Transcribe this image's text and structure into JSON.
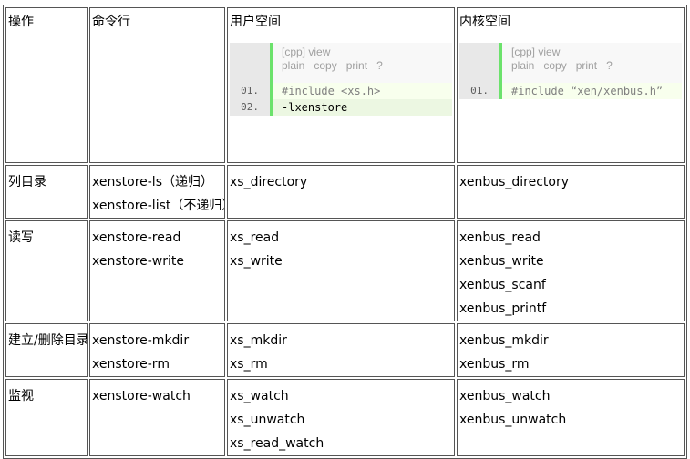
{
  "headers": {
    "op": "操作",
    "cli": "命令行",
    "user": "用户空间",
    "kernel": "内核空间"
  },
  "code_user": {
    "lang": "[cpp]",
    "view": "view",
    "tools": [
      "plain",
      "copy",
      "print",
      "?"
    ],
    "lines": [
      {
        "num": "01.",
        "text": "#include <xs.h>"
      },
      {
        "num": "02.",
        "text": "-lxenstore"
      }
    ]
  },
  "code_kernel": {
    "lang": "[cpp]",
    "view": "view",
    "tools": [
      "plain",
      "copy",
      "print",
      "?"
    ],
    "lines": [
      {
        "num": "01.",
        "text": "#include “xen/xenbus.h”"
      }
    ]
  },
  "rows": [
    {
      "op": "列目录",
      "cli": [
        "xenstore-ls（递归）",
        "xenstore-list（不递归）"
      ],
      "user": [
        "xs_directory"
      ],
      "kernel": [
        "xenbus_directory"
      ]
    },
    {
      "op": "读写",
      "cli": [
        "xenstore-read",
        "xenstore-write"
      ],
      "user": [
        "xs_read",
        "xs_write"
      ],
      "kernel": [
        "xenbus_read",
        "xenbus_write",
        "xenbus_scanf",
        "xenbus_printf"
      ]
    },
    {
      "op": "建立/删除目录",
      "cli": [
        "xenstore-mkdir",
        "xenstore-rm"
      ],
      "user": [
        "xs_mkdir",
        "xs_rm"
      ],
      "kernel": [
        "xenbus_mkdir",
        "xenbus_rm"
      ]
    },
    {
      "op": "监视",
      "cli": [
        "xenstore-watch"
      ],
      "user": [
        "xs_watch",
        "xs_unwatch",
        "xs_read_watch"
      ],
      "kernel": [
        "xenbus_watch",
        "xenbus_unwatch"
      ]
    }
  ]
}
